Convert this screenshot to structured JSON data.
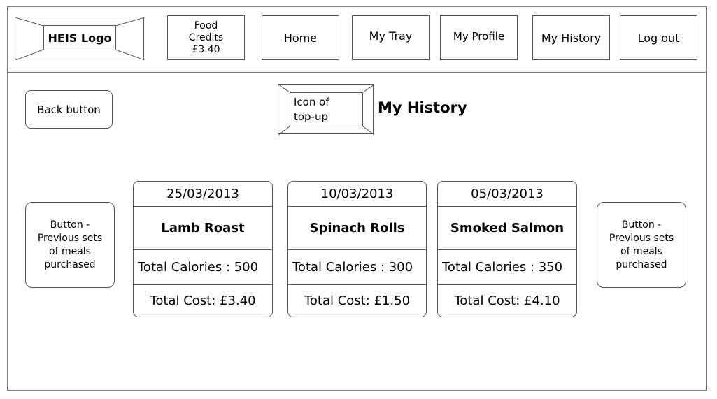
{
  "header": {
    "logo_label": "HEIS Logo",
    "credits_title": "Food\nCredits",
    "credits_amount": "£3.40",
    "nav": [
      {
        "label": "Home"
      },
      {
        "label": "My Tray"
      },
      {
        "label": "My Profile"
      },
      {
        "label": "My History"
      },
      {
        "label": "Log out"
      }
    ]
  },
  "page": {
    "back_label": "Back button",
    "icon_label": "Icon of\ntop-up",
    "title": "My History"
  },
  "side_buttons": {
    "left_label": "Button -\nPrevious sets\nof meals\npurchased",
    "right_label": "Button -\nPrevious sets\nof meals\npurchased"
  },
  "meals": [
    {
      "date": "25/03/2013",
      "name": "Lamb Roast",
      "calories": "Total Calories : 500",
      "cost": "Total Cost: £3.40"
    },
    {
      "date": "10/03/2013",
      "name": "Spinach Rolls",
      "calories": "Total Calories : 300",
      "cost": "Total Cost: £1.50"
    },
    {
      "date": "05/03/2013",
      "name": "Smoked Salmon",
      "calories": "Total Calories : 350",
      "cost": "Total Cost: £4.10"
    }
  ]
}
